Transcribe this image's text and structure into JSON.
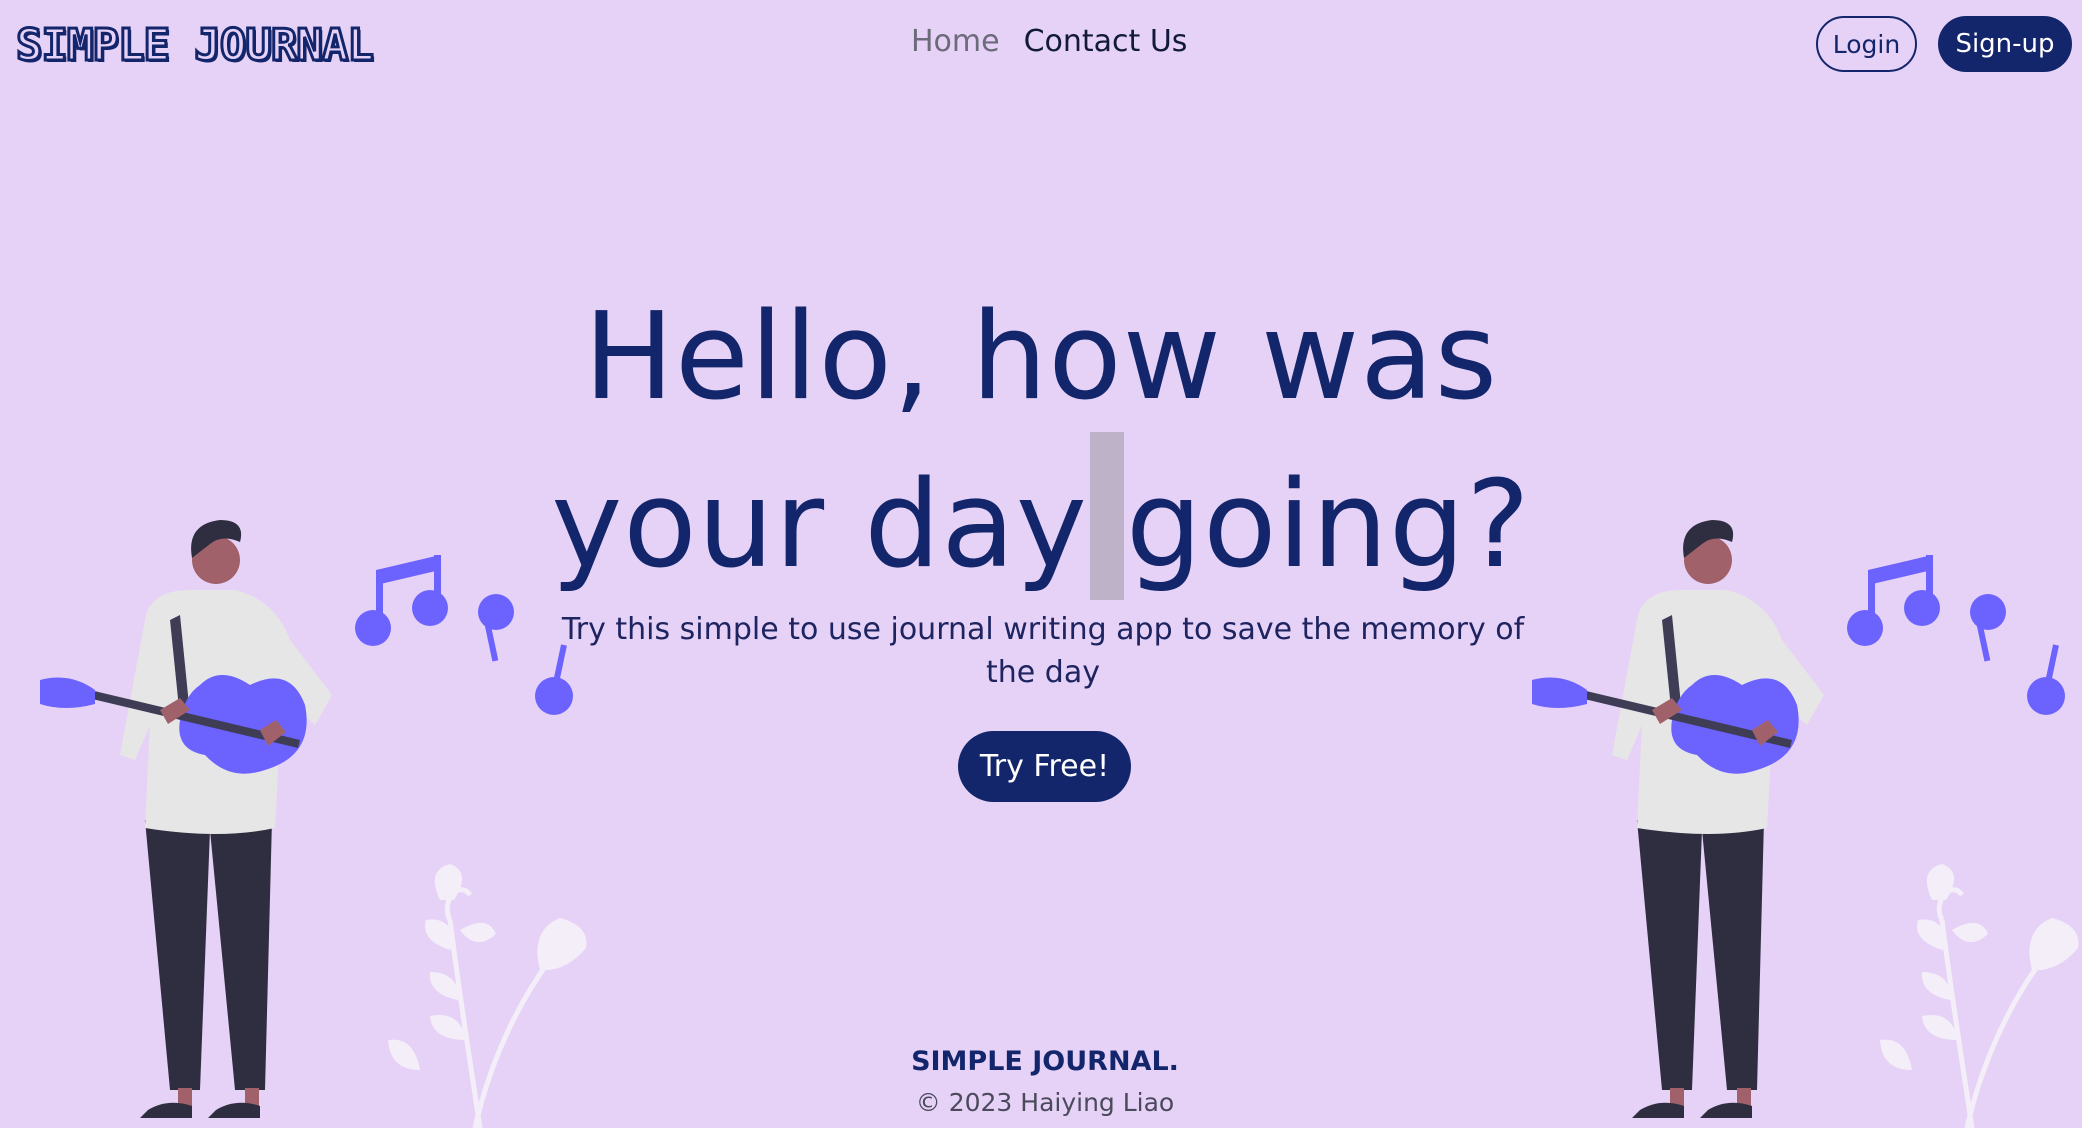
{
  "header": {
    "logo": "SIMPLE JOURNAL",
    "nav": [
      {
        "label": "Home"
      },
      {
        "label": "Contact Us"
      }
    ],
    "login_label": "Login",
    "signup_label": "Sign-up"
  },
  "hero": {
    "line1": "Hello, how was",
    "line2_a": "your day",
    "line2_b": "going?",
    "subtitle": "Try this simple to use journal writing app to save the memory of the day",
    "cta_label": "Try Free!"
  },
  "footer": {
    "brand": "SIMPLE JOURNAL.",
    "copyright": "© 2023 Haiying Liao"
  },
  "colors": {
    "background": "#e7d2f7",
    "primary": "#13266b",
    "accent_purple": "#6c63ff",
    "figure_dark": "#2f2e41",
    "skin": "#a0616a"
  },
  "icons": [
    "guitar-player-illustration",
    "music-note-icon",
    "plant-illustration"
  ]
}
